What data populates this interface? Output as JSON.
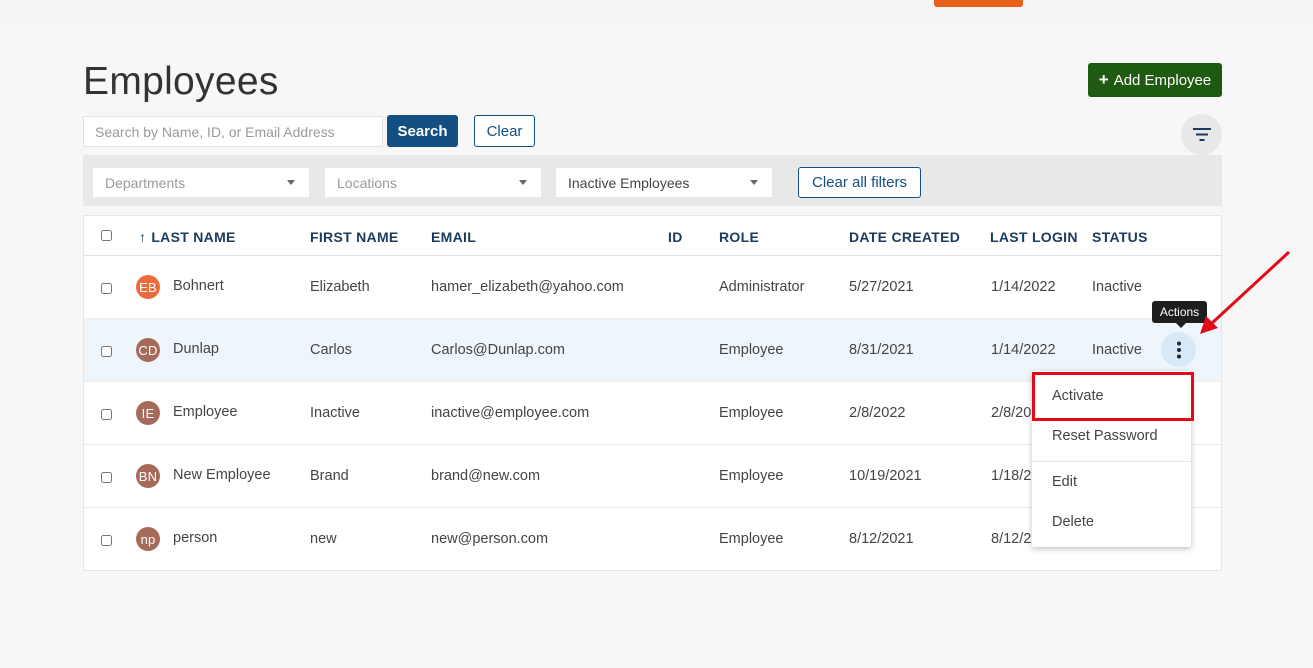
{
  "page": {
    "title": "Employees"
  },
  "toolbar": {
    "add_employee_label": "Add Employee"
  },
  "search": {
    "placeholder": "Search by Name, ID, or Email Address",
    "value": "",
    "search_label": "Search",
    "clear_label": "Clear"
  },
  "filters": {
    "departments_placeholder": "Departments",
    "locations_placeholder": "Locations",
    "status_value": "Inactive Employees",
    "clear_all_label": "Clear all filters"
  },
  "table": {
    "columns": {
      "last_name": "LAST NAME",
      "first_name": "FIRST NAME",
      "email": "EMAIL",
      "id": "ID",
      "role": "ROLE",
      "date_created": "DATE CREATED",
      "last_login": "LAST LOGIN",
      "status": "STATUS"
    },
    "rows": [
      {
        "initials": "EB",
        "avatar_color": "#ec6b3d",
        "last_name": "Bohnert",
        "first_name": "Elizabeth",
        "email": "hamer_elizabeth@yahoo.com",
        "id": "",
        "role": "Administrator",
        "date_created": "5/27/2021",
        "last_login": "1/14/2022",
        "status": "Inactive"
      },
      {
        "initials": "CD",
        "avatar_color": "#a56a5a",
        "last_name": "Dunlap",
        "first_name": "Carlos",
        "email": "Carlos@Dunlap.com",
        "id": "",
        "role": "Employee",
        "date_created": "8/31/2021",
        "last_login": "1/14/2022",
        "status": "Inactive"
      },
      {
        "initials": "IE",
        "avatar_color": "#a56a5a",
        "last_name": "Employee",
        "first_name": "Inactive",
        "email": "inactive@employee.com",
        "id": "",
        "role": "Employee",
        "date_created": "2/8/2022",
        "last_login": "2/8/20",
        "status": ""
      },
      {
        "initials": "BN",
        "avatar_color": "#a56a5a",
        "last_name": "New Employee",
        "first_name": "Brand",
        "email": "brand@new.com",
        "id": "",
        "role": "Employee",
        "date_created": "10/19/2021",
        "last_login": "1/18/2",
        "status": ""
      },
      {
        "initials": "np",
        "avatar_color": "#a56a5a",
        "last_name": "person",
        "first_name": "new",
        "email": "new@person.com",
        "id": "",
        "role": "Employee",
        "date_created": "8/12/2021",
        "last_login": "8/12/2",
        "status": ""
      }
    ]
  },
  "actions": {
    "tooltip": "Actions",
    "menu": {
      "activate": "Activate",
      "reset_password": "Reset Password",
      "edit": "Edit",
      "delete": "Delete"
    }
  },
  "colors": {
    "primary_blue": "#134f80",
    "add_green": "#1f5a12",
    "top_accent": "#e8611a",
    "callout_red": "#e30a18",
    "row_highlight": "#eef5fb"
  }
}
